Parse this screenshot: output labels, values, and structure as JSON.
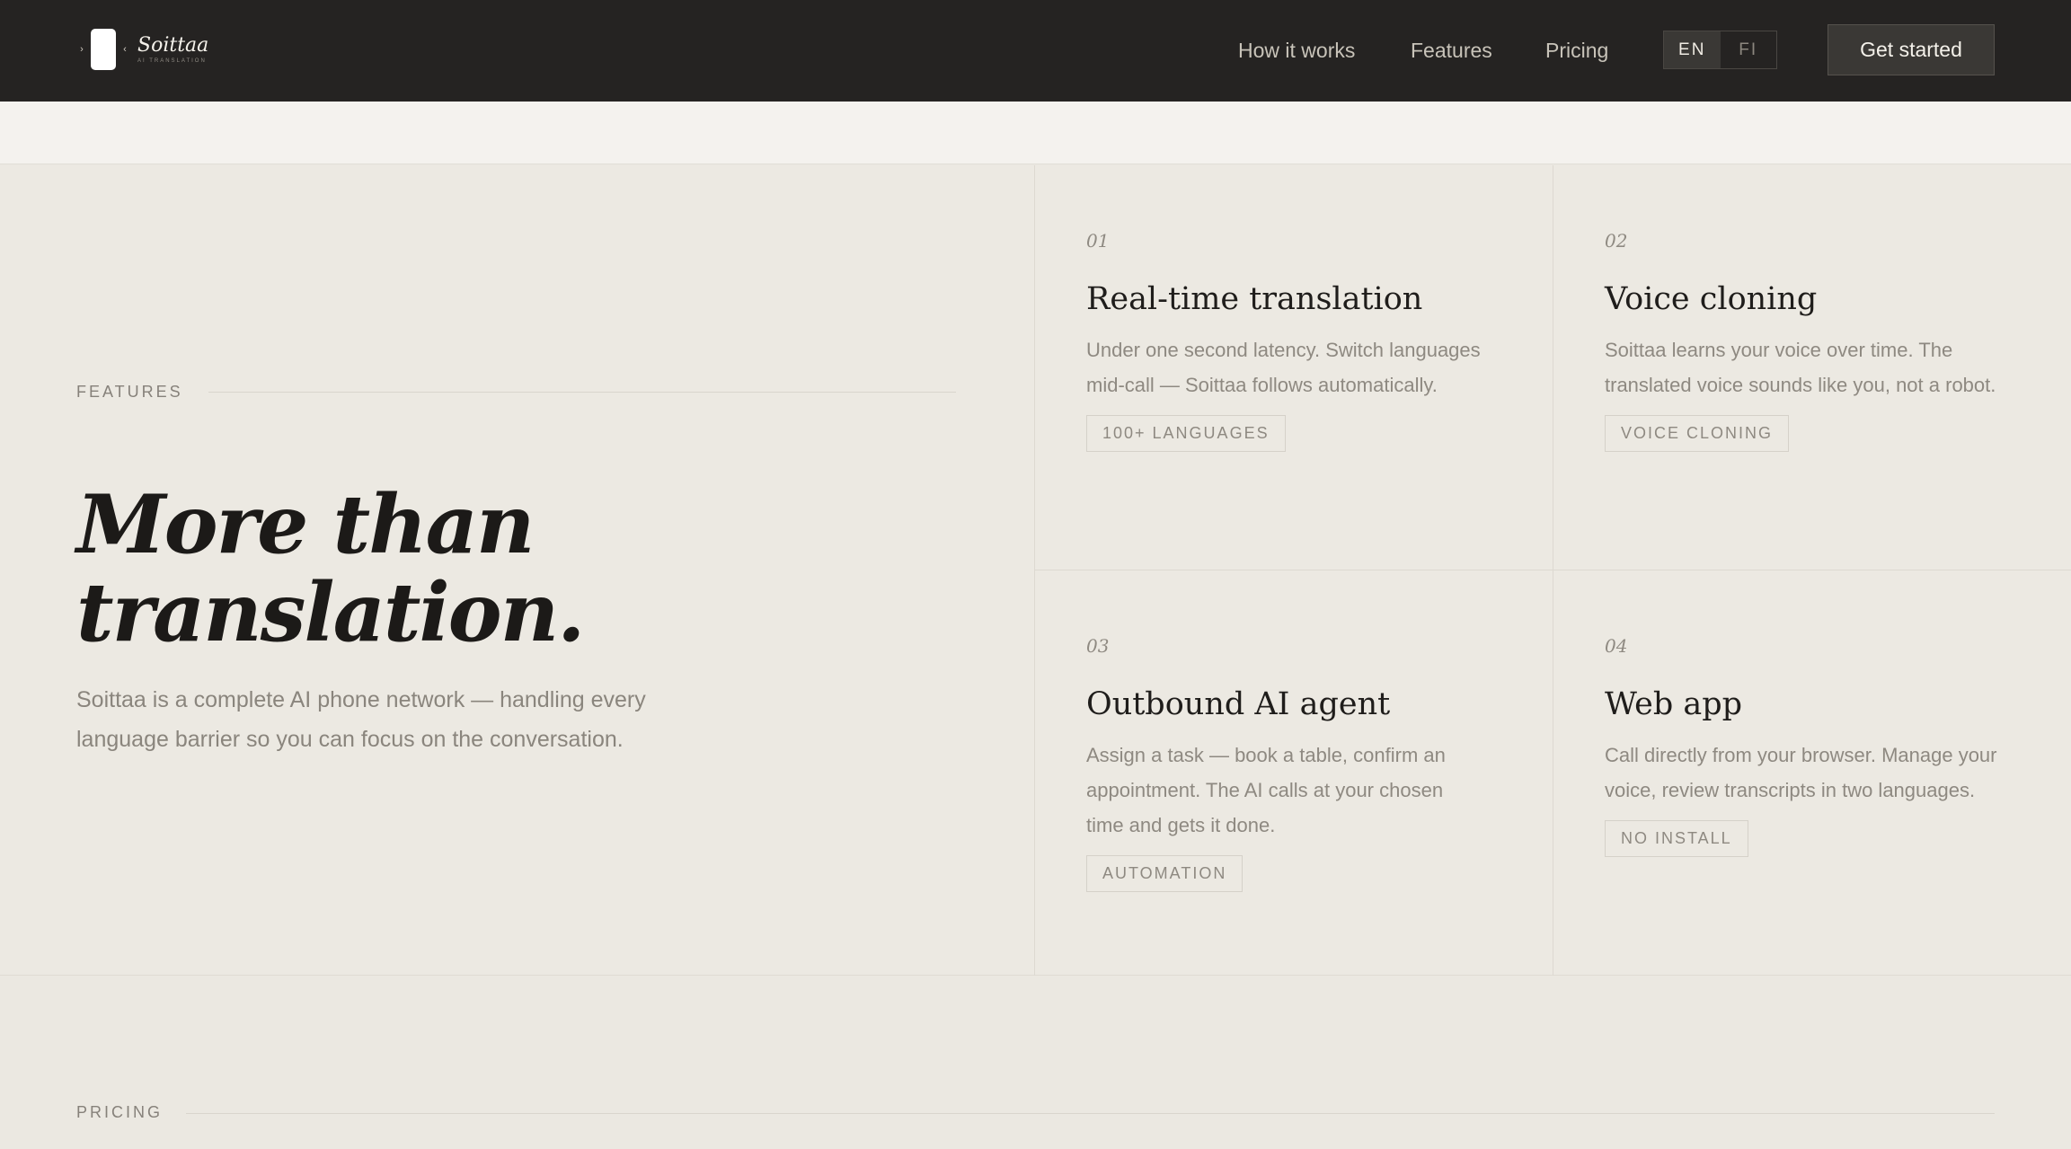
{
  "header": {
    "logo": {
      "name": "Soittaa",
      "subtitle": "AI TRANSLATION",
      "icon": "phone-logo-icon"
    },
    "nav": [
      {
        "label": "How it works"
      },
      {
        "label": "Features"
      },
      {
        "label": "Pricing"
      }
    ],
    "languages": [
      {
        "code": "EN",
        "active": true
      },
      {
        "code": "FI",
        "active": false
      }
    ],
    "cta_label": "Get started"
  },
  "features": {
    "section_label": "FEATURES",
    "headline_line1": "More than",
    "headline_line2": "translation.",
    "intro": "Soittaa is a complete AI phone network — handling every language barrier so you can focus on the conversation.",
    "cards": [
      {
        "number": "01",
        "title": "Real-time translation",
        "description": "Under one second latency. Switch languages mid-call — Soittaa follows automatically.",
        "tag": "100+ LANGUAGES"
      },
      {
        "number": "02",
        "title": "Voice cloning",
        "description": "Soittaa learns your voice over time. The translated voice sounds like you, not a robot.",
        "tag": "VOICE CLONING"
      },
      {
        "number": "03",
        "title": "Outbound AI agent",
        "description": "Assign a task — book a table, confirm an appointment. The AI calls at your chosen time and gets it done.",
        "tag": "AUTOMATION"
      },
      {
        "number": "04",
        "title": "Web app",
        "description": "Call directly from your browser. Manage your voice, review transcripts in two languages.",
        "tag": "NO INSTALL"
      }
    ]
  },
  "pricing": {
    "section_label": "PRICING"
  },
  "colors": {
    "header_bg": "#252322",
    "page_bg": "#ece9e2",
    "heading": "#1c1a18",
    "muted_text": "#8a857d",
    "cta_bg": "#3a3835"
  }
}
